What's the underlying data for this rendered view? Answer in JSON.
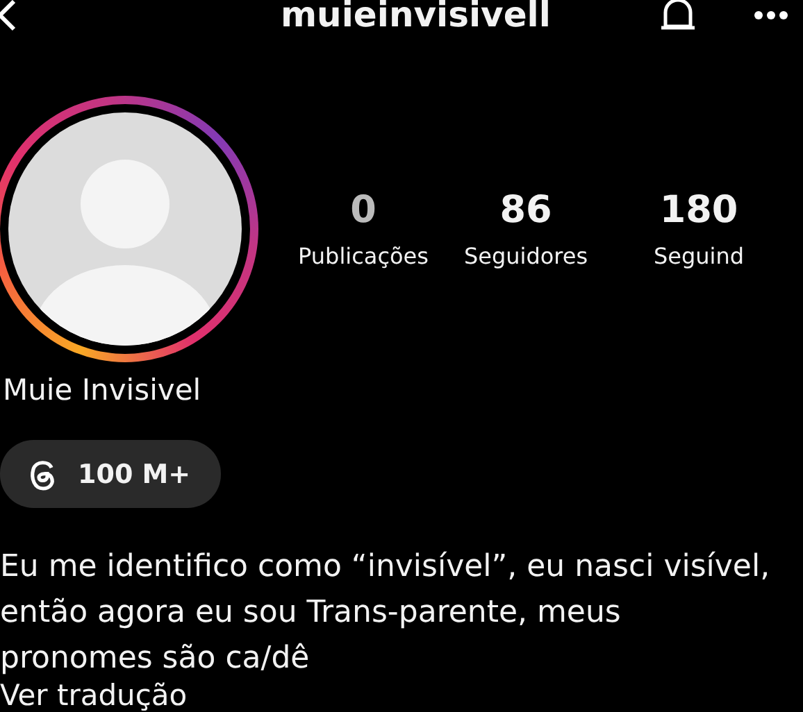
{
  "header": {
    "title": "muieinvisivell"
  },
  "profile": {
    "name": "Muie Invisivel",
    "has_story": true
  },
  "stats": [
    {
      "value": "0",
      "label": "Publicações"
    },
    {
      "value": "86",
      "label": "Seguidores"
    },
    {
      "value": "180",
      "label": "Seguind"
    }
  ],
  "threads_badge": {
    "label": "100 M+"
  },
  "bio": "Eu me identifico como “invisível”, eu nasci visível, então agora eu sou Trans-parente, meus pronomes são ca/dê",
  "translate_link": "Ver tradução"
}
